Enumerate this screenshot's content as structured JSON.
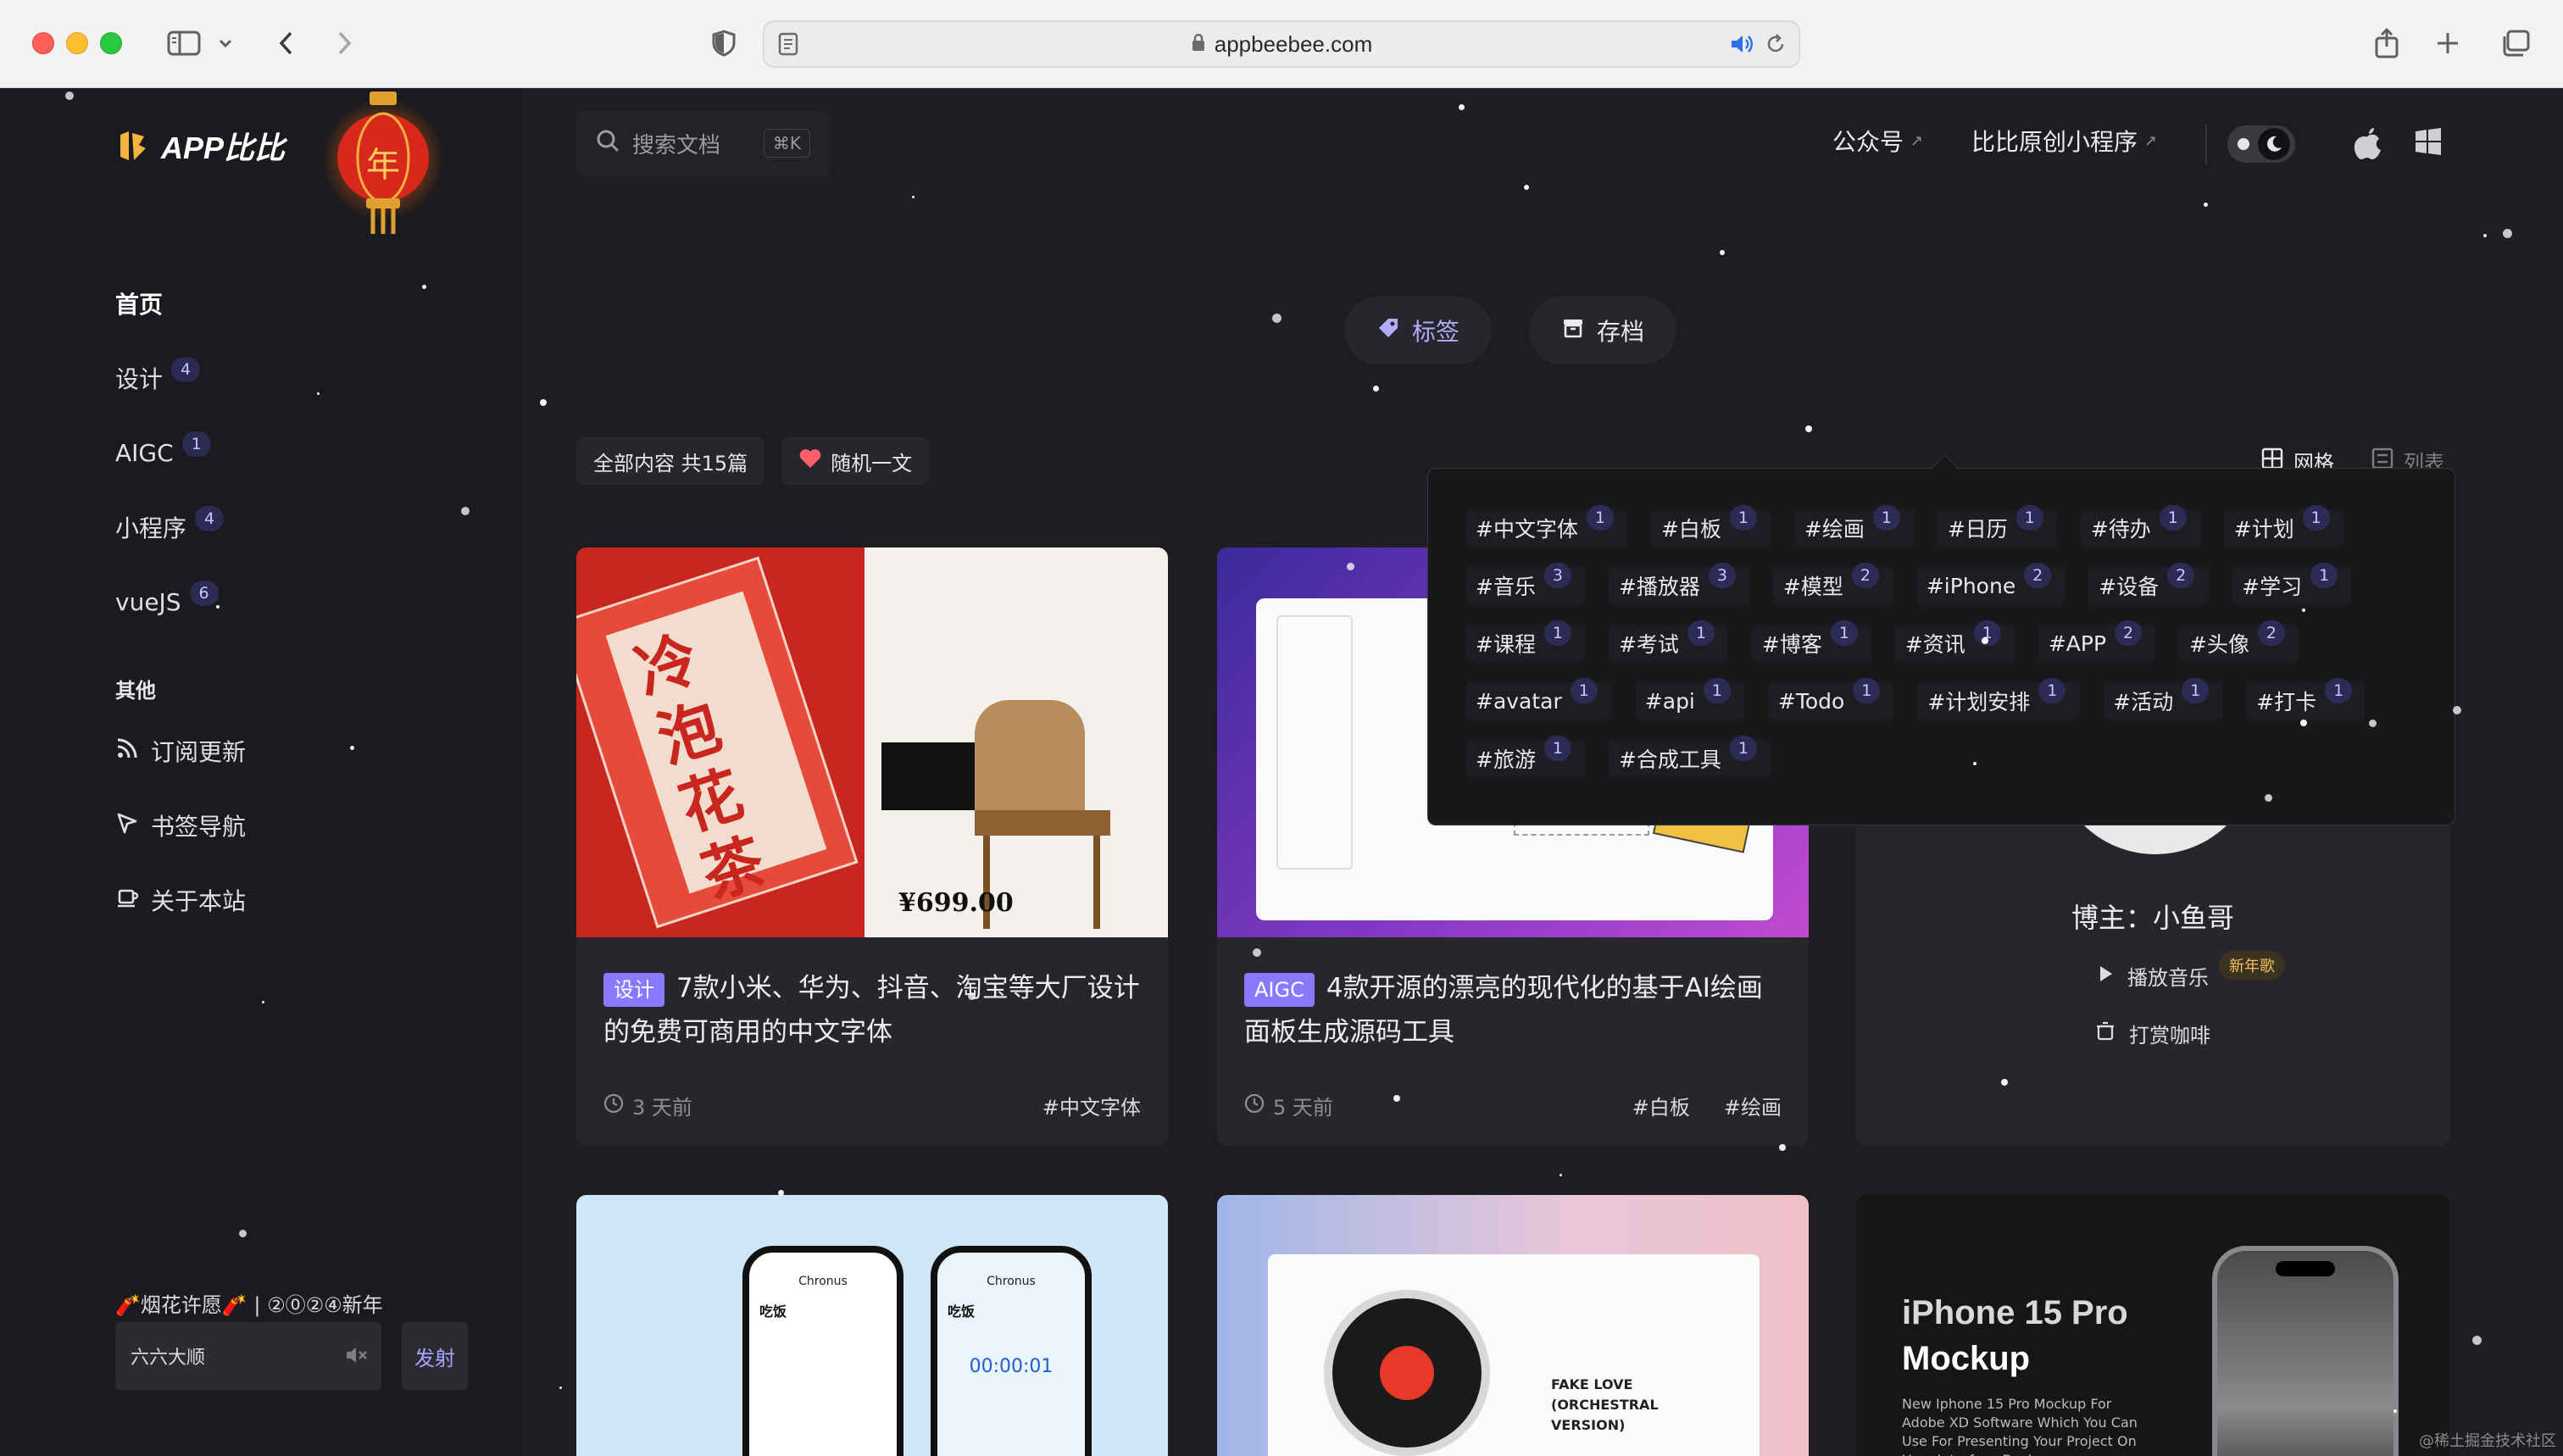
{
  "browser": {
    "url": "appbeebee.com"
  },
  "site": {
    "logo_text": "APP比比",
    "lantern_char": "年",
    "search": {
      "placeholder": "搜索文档",
      "shortcut": "⌘K"
    },
    "top_links": [
      {
        "label": "公众号",
        "arrow": "↗"
      },
      {
        "label": "比比原创小程序",
        "arrow": "↗"
      }
    ]
  },
  "sidebar": {
    "items": [
      {
        "label": "首页",
        "count": null
      },
      {
        "label": "设计",
        "count": "4"
      },
      {
        "label": "AIGC",
        "count": "1"
      },
      {
        "label": "小程序",
        "count": "4"
      },
      {
        "label": "vueJS",
        "count": "6"
      }
    ],
    "section_title": "其他",
    "others": [
      {
        "label": "订阅更新",
        "icon": "rss-icon"
      },
      {
        "label": "书签导航",
        "icon": "cursor-icon"
      },
      {
        "label": "关于本站",
        "icon": "cup-icon"
      }
    ],
    "fireworks": {
      "title": "🧨烟花许愿🧨 | ②⓪②④新年",
      "input_value": "六六大顺",
      "send_label": "发射"
    }
  },
  "tabs": [
    {
      "label": "标签",
      "icon": "tag-icon",
      "active": true
    },
    {
      "label": "存档",
      "icon": "archive-icon",
      "active": false
    }
  ],
  "filter": {
    "all_label": "全部内容 共15篇",
    "random_label": "随机一文"
  },
  "view_toggle": {
    "grid_label": "网格",
    "list_label": "列表"
  },
  "tags_popover": {
    "rows": [
      [
        {
          "name": "#中文字体",
          "count": "1"
        },
        {
          "name": "#白板",
          "count": "1"
        },
        {
          "name": "#绘画",
          "count": "1"
        },
        {
          "name": "#日历",
          "count": "1"
        },
        {
          "name": "#待办",
          "count": "1"
        },
        {
          "name": "#计划",
          "count": "1"
        }
      ],
      [
        {
          "name": "#音乐",
          "count": "3"
        },
        {
          "name": "#播放器",
          "count": "3"
        },
        {
          "name": "#模型",
          "count": "2"
        },
        {
          "name": "#iPhone",
          "count": "2"
        },
        {
          "name": "#设备",
          "count": "2"
        },
        {
          "name": "#学习",
          "count": "1"
        }
      ],
      [
        {
          "name": "#课程",
          "count": "1"
        },
        {
          "name": "#考试",
          "count": "1"
        },
        {
          "name": "#博客",
          "count": "1"
        },
        {
          "name": "#资讯",
          "count": "1"
        },
        {
          "name": "#APP",
          "count": "2"
        },
        {
          "name": "#头像",
          "count": "2"
        }
      ],
      [
        {
          "name": "#avatar",
          "count": "1"
        },
        {
          "name": "#api",
          "count": "1"
        },
        {
          "name": "#Todo",
          "count": "1"
        },
        {
          "name": "#计划安排",
          "count": "1"
        },
        {
          "name": "#活动",
          "count": "1"
        },
        {
          "name": "#打卡",
          "count": "1"
        }
      ],
      [
        {
          "name": "#旅游",
          "count": "1"
        },
        {
          "name": "#合成工具",
          "count": "1"
        }
      ]
    ]
  },
  "cards": [
    {
      "badge": "设计",
      "title": "7款小米、华为、抖音、淘宝等大厂设计的免费可商用的中文字体",
      "time": "3 天前",
      "tags": [
        "#中文字体"
      ],
      "img_text": {
        "big": "冷泡花茶",
        "price": "¥699.00"
      }
    },
    {
      "badge": "AIGC",
      "title": "4款开源的漂亮的现代化的基于AI绘画面板生成源码工具",
      "time": "5 天前",
      "tags": [
        "#白板",
        "#绘画"
      ]
    }
  ],
  "blogger": {
    "name": "博主：小鱼哥",
    "music_label": "播放音乐",
    "music_badge": "新年歌",
    "coffee_label": "打赏咖啡"
  },
  "bottom_cards": {
    "timer_app": {
      "app": "Chronus",
      "task": "吃饭",
      "time": "00:00:01"
    },
    "music": {
      "song": "FAKE LOVE (ORCHESTRAL VERSION)"
    },
    "iphone": {
      "title_line1": "iPhone 15 Pro",
      "title_line2": "Mockup",
      "desc": "New Iphone 15 Pro Mockup For Adobe XD Software Which You Can Use For Presenting Your Project On User Interface Design"
    }
  },
  "watermark": "@稀土掘金技术社区",
  "colors": {
    "accent": "#8a79ff",
    "badge_bg": "#2b2b56",
    "page_bg": "#1d1d22",
    "sidebar_bg": "#1b1b1f"
  }
}
